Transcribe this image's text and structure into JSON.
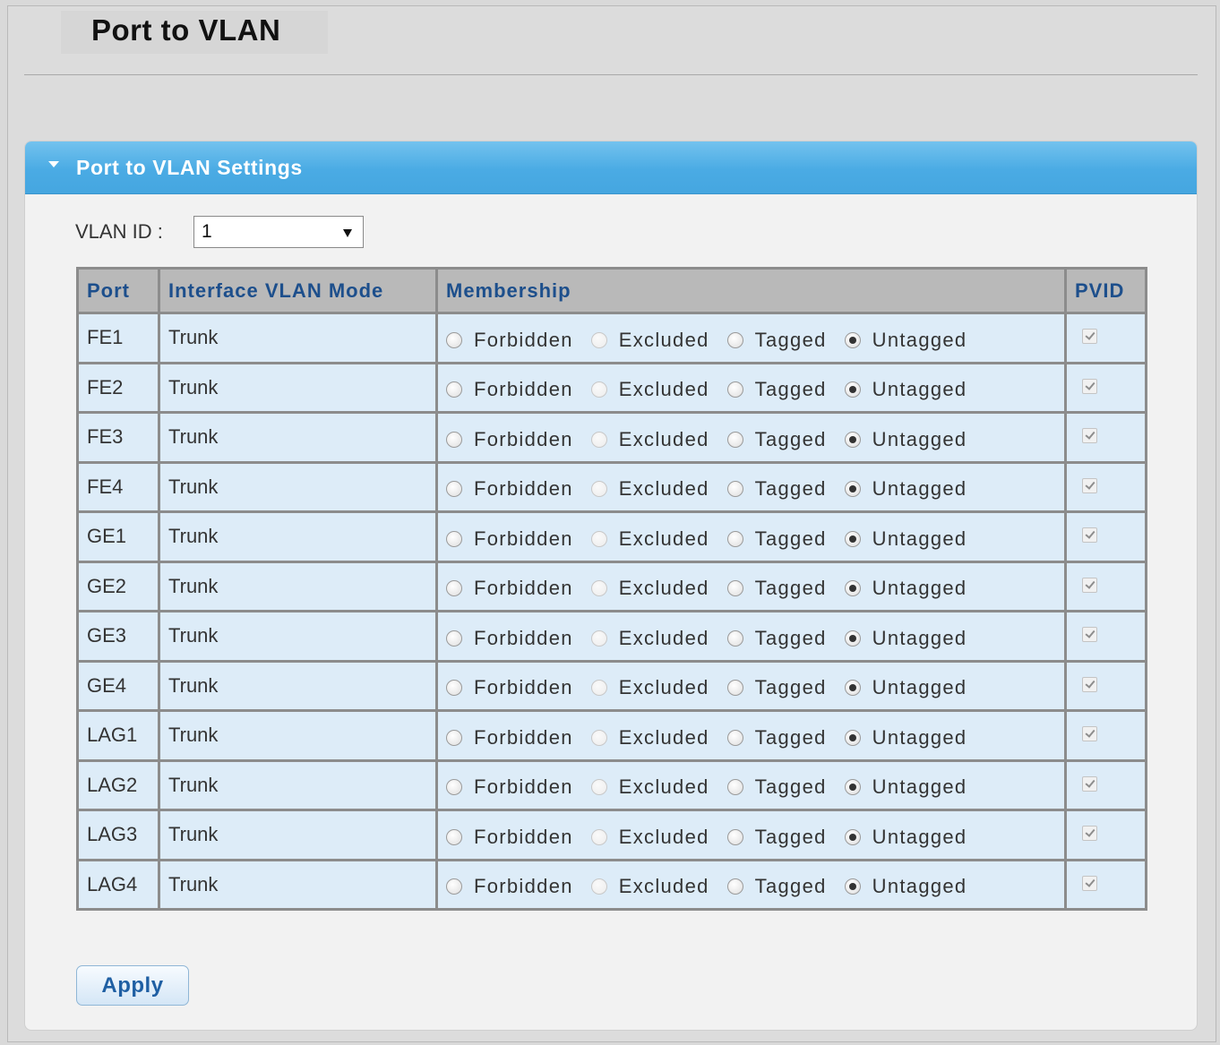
{
  "page": {
    "title": "Port to VLAN"
  },
  "panel": {
    "title": "Port to VLAN Settings"
  },
  "vlan_select": {
    "label": "VLAN ID :",
    "value": "1"
  },
  "table": {
    "headers": [
      "Port",
      "Interface VLAN Mode",
      "Membership",
      "PVID"
    ],
    "membership_options": [
      "Forbidden",
      "Excluded",
      "Tagged",
      "Untagged"
    ],
    "rows": [
      {
        "port": "FE1",
        "mode": "Trunk",
        "membership": "Untagged",
        "pvid": true
      },
      {
        "port": "FE2",
        "mode": "Trunk",
        "membership": "Untagged",
        "pvid": true
      },
      {
        "port": "FE3",
        "mode": "Trunk",
        "membership": "Untagged",
        "pvid": true
      },
      {
        "port": "FE4",
        "mode": "Trunk",
        "membership": "Untagged",
        "pvid": true
      },
      {
        "port": "GE1",
        "mode": "Trunk",
        "membership": "Untagged",
        "pvid": true
      },
      {
        "port": "GE2",
        "mode": "Trunk",
        "membership": "Untagged",
        "pvid": true
      },
      {
        "port": "GE3",
        "mode": "Trunk",
        "membership": "Untagged",
        "pvid": true
      },
      {
        "port": "GE4",
        "mode": "Trunk",
        "membership": "Untagged",
        "pvid": true
      },
      {
        "port": "LAG1",
        "mode": "Trunk",
        "membership": "Untagged",
        "pvid": true
      },
      {
        "port": "LAG2",
        "mode": "Trunk",
        "membership": "Untagged",
        "pvid": true
      },
      {
        "port": "LAG3",
        "mode": "Trunk",
        "membership": "Untagged",
        "pvid": true
      },
      {
        "port": "LAG4",
        "mode": "Trunk",
        "membership": "Untagged",
        "pvid": true
      }
    ]
  },
  "buttons": {
    "apply": "Apply"
  },
  "colors": {
    "panel_header": "#4aabe4",
    "header_text": "#1d4f8c",
    "row_background": "#ddecf8",
    "table_border": "#8c8c8c"
  }
}
